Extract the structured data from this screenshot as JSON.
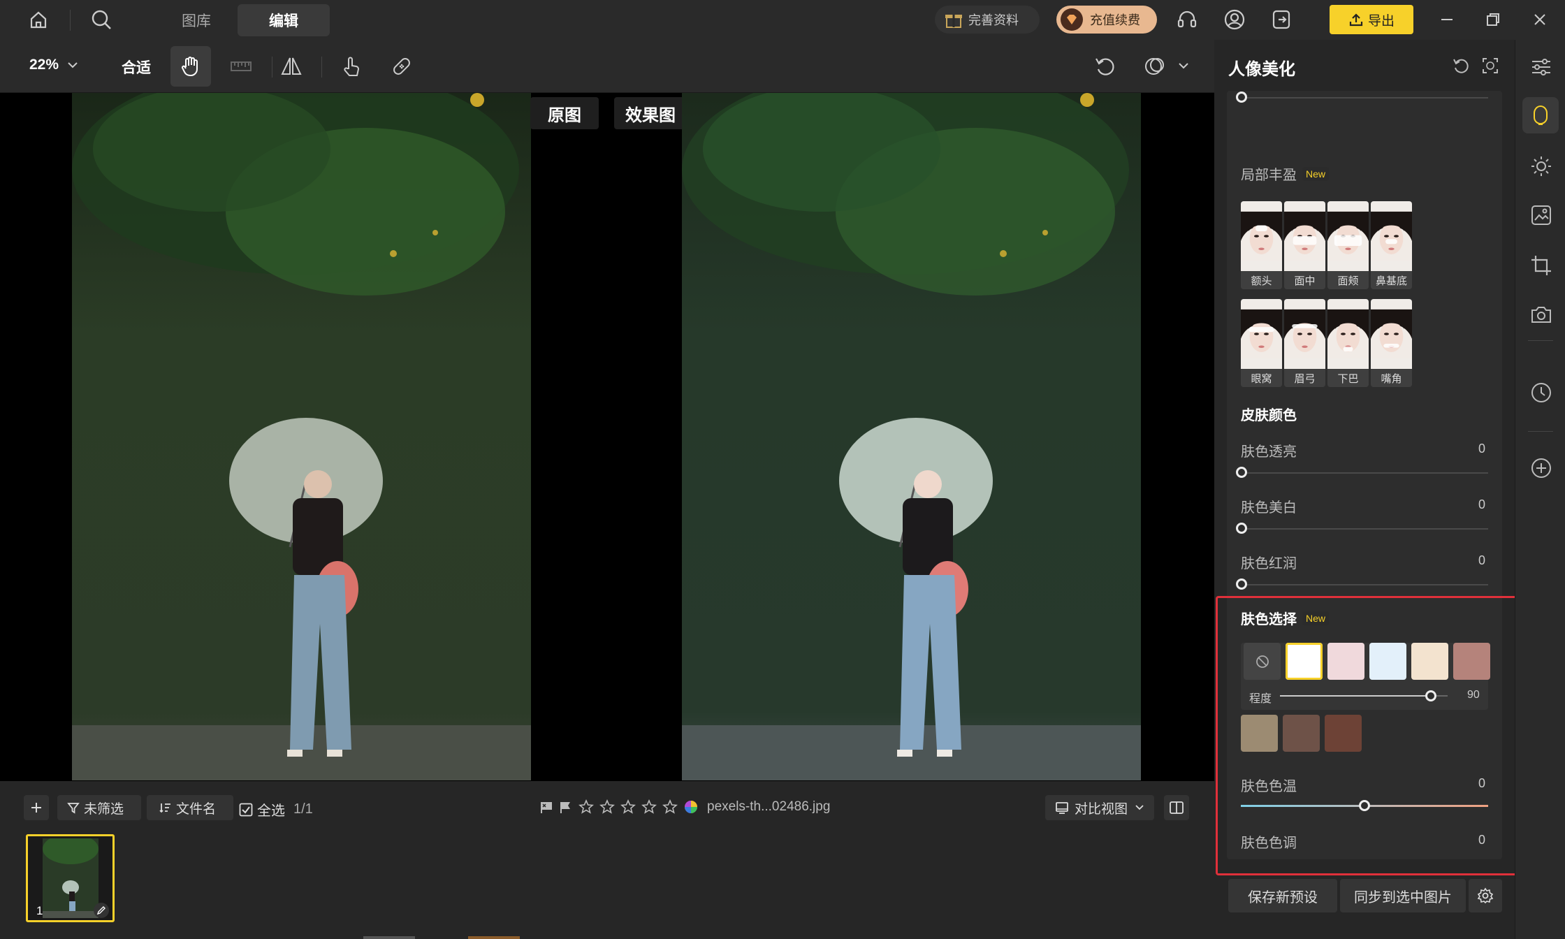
{
  "topbar": {
    "tabs": [
      "图库",
      "编辑"
    ],
    "active_tab": 1,
    "complete_info": "完善资料",
    "recharge": "充值续费",
    "export": "导出"
  },
  "toolbar": {
    "zoom": "22%",
    "fit": "合适"
  },
  "canvas": {
    "label_original": "原图",
    "label_effect": "效果图"
  },
  "film": {
    "filter": "未筛选",
    "sort": "文件名",
    "select_all": "全选",
    "count": "1/1",
    "filename": "pexels-th...02486.jpg",
    "view": "对比视图",
    "thumb_index": "1"
  },
  "panel": {
    "title": "人像美化",
    "local_fill": {
      "title": "局部丰盈",
      "badge": "New",
      "items": [
        "额头",
        "面中",
        "面颊",
        "鼻基底",
        "眼窝",
        "眉弓",
        "下巴",
        "嘴角"
      ]
    },
    "skin_color": {
      "title": "皮肤颜色",
      "sliders": [
        {
          "label": "肤色透亮",
          "value": "0"
        },
        {
          "label": "肤色美白",
          "value": "0"
        },
        {
          "label": "肤色红润",
          "value": "0"
        }
      ]
    },
    "skin_select": {
      "title": "肤色选择",
      "badge": "New",
      "swatches_row1": [
        "#ffffff",
        "#f0d9dc",
        "#e3f0fa",
        "#f3e3cf",
        "#b5837b"
      ],
      "swatches_row2": [
        "#9c8b72",
        "#6e5248",
        "#6d4236"
      ],
      "degree_label": "程度",
      "degree_value": "90",
      "temp_label": "肤色色温",
      "temp_value": "0",
      "tone_label": "肤色色调",
      "tone_value": "0"
    },
    "save_preset": "保存新预设",
    "sync": "同步到选中图片"
  },
  "colors": {
    "accent_yellow": "#f7d12a",
    "highlight_red": "#e0303a"
  }
}
